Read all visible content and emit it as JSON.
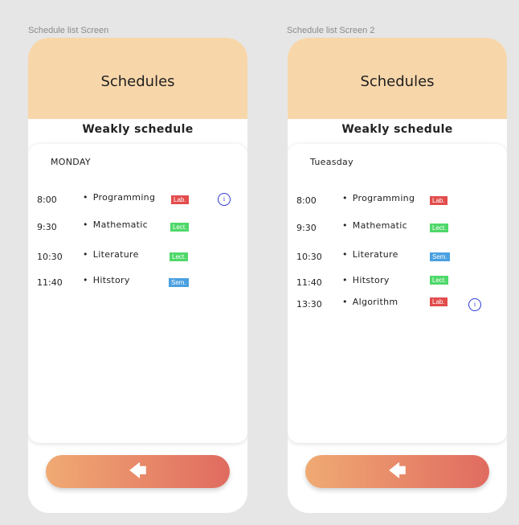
{
  "colors": {
    "lab": "#e24c4c",
    "lect": "#4fd86a",
    "sem": "#4aa0e0",
    "header": "#f7d6aa"
  },
  "screens": [
    {
      "label": "Schedule list Screen",
      "header_title": "Schedules",
      "subtitle": "Weakly schedule",
      "day": "MONDAY",
      "items": [
        {
          "time": "8:00",
          "subject": "Programming",
          "badge": "Lab.",
          "type": "lab",
          "info": "i"
        },
        {
          "time": "9:30",
          "subject": "Mathematic",
          "badge": "Lect.",
          "type": "lect"
        },
        {
          "time": "10:30",
          "subject": "Literature",
          "badge": "Lect.",
          "type": "lect"
        },
        {
          "time": "11:40",
          "subject": "Hitstory",
          "badge": "Sem.",
          "type": "sem"
        }
      ],
      "back_icon": "arrow-left-icon"
    },
    {
      "label": "Schedule list Screen 2",
      "header_title": "Schedules",
      "subtitle": "Weakly schedule",
      "day": "Tueasday",
      "items": [
        {
          "time": "8:00",
          "subject": "Programming",
          "badge": "Lab.",
          "type": "lab"
        },
        {
          "time": "9:30",
          "subject": "Mathematic",
          "badge": "Lect.",
          "type": "lect"
        },
        {
          "time": "10:30",
          "subject": "Literature",
          "badge": "Sem.",
          "type": "sem"
        },
        {
          "time": "11:40",
          "subject": "Hitstory",
          "badge": "Lect.",
          "type": "lect"
        },
        {
          "time": "13:30",
          "subject": "Algorithm",
          "badge": "Lab.",
          "type": "lab",
          "info": "i"
        }
      ],
      "back_icon": "arrow-left-icon"
    }
  ]
}
